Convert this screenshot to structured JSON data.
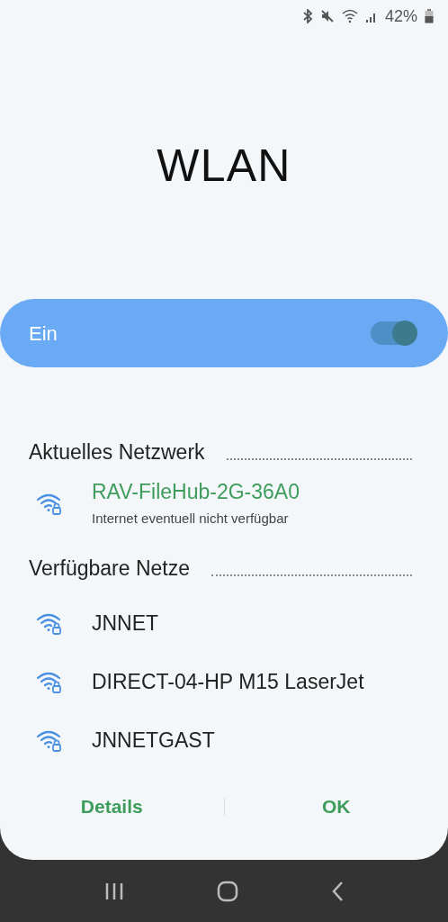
{
  "status_bar": {
    "battery": "42%"
  },
  "title": "WLAN",
  "master_switch": {
    "label": "Ein",
    "on": true
  },
  "current_section": {
    "title": "Aktuelles Netzwerk",
    "networks": [
      {
        "name": "RAV-FileHub-2G-36A0",
        "status": "Internet eventuell nicht verfügbar",
        "connected": true
      }
    ]
  },
  "available_section": {
    "title": "Verfügbare Netze",
    "networks": [
      {
        "name": "JNNET",
        "connected": false
      },
      {
        "name": "DIRECT-04-HP M15 LaserJet",
        "connected": false
      },
      {
        "name": "JNNETGAST",
        "connected": false
      }
    ]
  },
  "buttons": [
    "Details",
    "OK"
  ]
}
